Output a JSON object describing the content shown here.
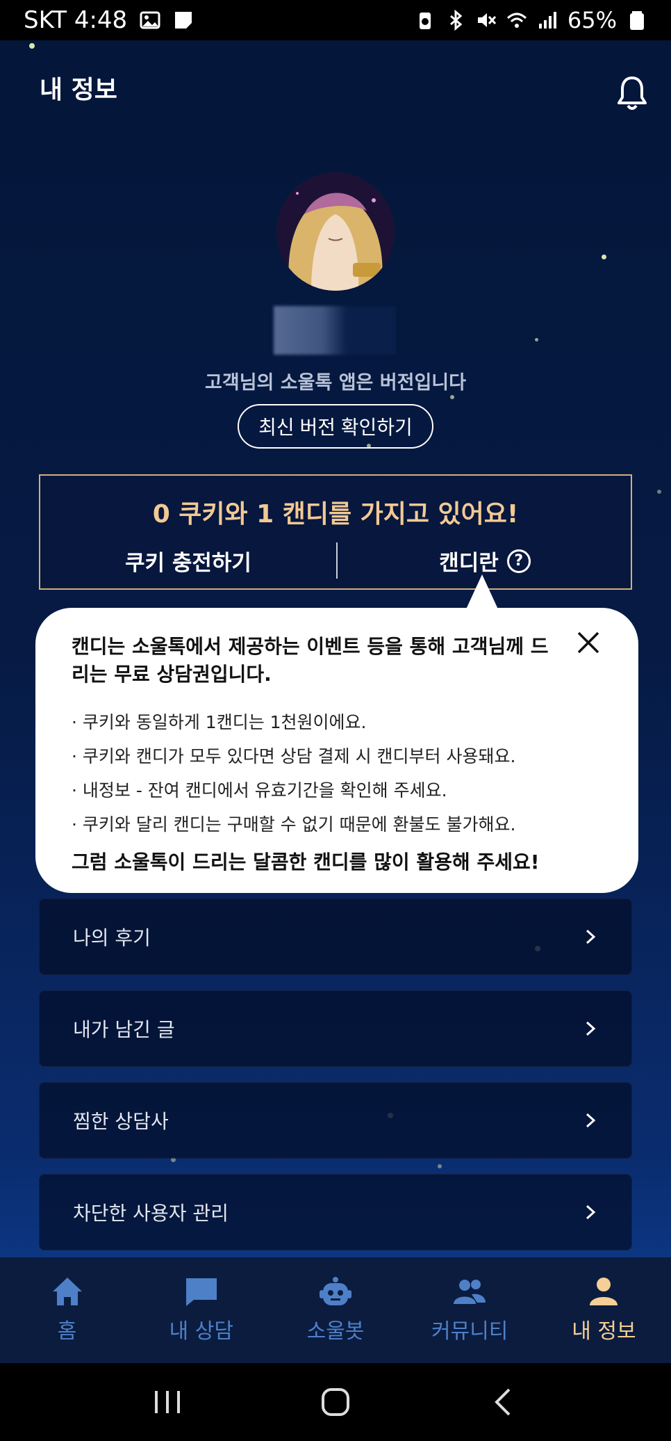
{
  "status_bar": {
    "carrier_time": "SKT 4:48",
    "battery": "65%"
  },
  "header": {
    "title": "내 정보"
  },
  "profile": {
    "version_text": "고객님의 소울톡 앱은  버전입니다",
    "check_version_label": "최신 버전 확인하기"
  },
  "wallet": {
    "summary": "0 쿠키와 1 캔디를 가지고 있어요!",
    "charge_label": "쿠키 충전하기",
    "candy_info_label": "캔디란"
  },
  "popover": {
    "heading": "캔디는 소울톡에서 제공하는 이벤트 등을 통해 고객님께 드리는 무료 상담권입니다.",
    "items": [
      "· 쿠키와 동일하게 1캔디는 1천원이에요.",
      "· 쿠키와 캔디가 모두 있다면 상담 결제 시 캔디부터 사용돼요.",
      "· 내정보 - 잔여 캔디에서 유효기간을 확인해 주세요.",
      "· 쿠키와 달리 캔디는 구매할 수 없기 때문에 환불도 불가해요."
    ],
    "footer": "그럼 소울톡이 드리는 달콤한 캔디를 많이 활용해 주세요!"
  },
  "menu": [
    {
      "label": "나의 후기"
    },
    {
      "label": "내가 남긴 글"
    },
    {
      "label": "찜한 상담사"
    },
    {
      "label": "차단한 사용자 관리"
    }
  ],
  "bottom_nav": [
    {
      "label": "홈",
      "icon": "home-icon"
    },
    {
      "label": "내 상담",
      "icon": "chat-icon"
    },
    {
      "label": "소울봇",
      "icon": "robot-icon"
    },
    {
      "label": "커뮤니티",
      "icon": "people-icon"
    },
    {
      "label": "내 정보",
      "icon": "person-icon",
      "active": true
    }
  ],
  "colors": {
    "accent_gold": "#f2c994",
    "nav_inactive": "#4e80c8",
    "nav_active": "#f5cf95"
  }
}
